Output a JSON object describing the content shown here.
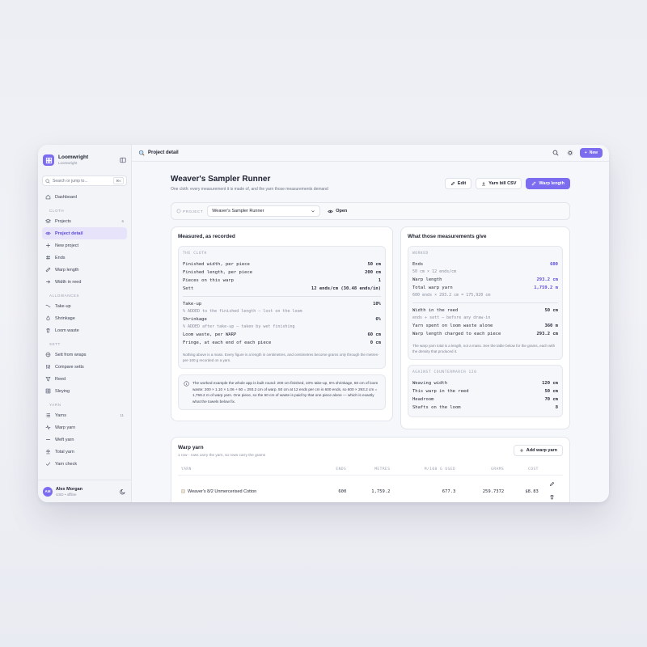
{
  "app": {
    "name": "Loomwright",
    "subtitle": "Loomwright"
  },
  "search": {
    "placeholder": "Search or jump to...",
    "shortcut": "⌘K"
  },
  "nav": {
    "top": [
      {
        "label": "Dashboard",
        "icon": "home-icon"
      }
    ],
    "cloth": {
      "heading": "CLOTH",
      "items": [
        {
          "label": "Projects",
          "count": "6",
          "icon": "layers-icon"
        },
        {
          "label": "Project detail",
          "icon": "eye-icon"
        },
        {
          "label": "New project",
          "icon": "plus-icon"
        },
        {
          "label": "Ends",
          "icon": "hash-icon"
        },
        {
          "label": "Warp length",
          "icon": "ruler-icon"
        },
        {
          "label": "Width in reed",
          "icon": "arrow-right-icon"
        }
      ]
    },
    "allowances": {
      "heading": "ALLOWANCES",
      "items": [
        {
          "label": "Take-up",
          "icon": "wave-icon"
        },
        {
          "label": "Shrinkage",
          "icon": "droplet-icon"
        },
        {
          "label": "Loom waste",
          "icon": "trash-icon"
        }
      ]
    },
    "sett": {
      "heading": "SETT",
      "items": [
        {
          "label": "Sett from wraps",
          "icon": "target-icon"
        },
        {
          "label": "Compare setts",
          "icon": "sliders-icon"
        },
        {
          "label": "Reed",
          "icon": "filter-icon"
        },
        {
          "label": "Sleying",
          "icon": "grid-icon"
        }
      ]
    },
    "yarn": {
      "heading": "YARN",
      "items": [
        {
          "label": "Yarns",
          "count": "11",
          "icon": "list-icon"
        },
        {
          "label": "Warp yarn",
          "icon": "activity-icon"
        },
        {
          "label": "Weft yarn",
          "icon": "minus-icon"
        },
        {
          "label": "Total yarn",
          "icon": "sum-icon"
        },
        {
          "label": "Yarn check",
          "icon": "check-icon"
        }
      ]
    }
  },
  "user": {
    "initials": "AM",
    "name": "Alex Morgan",
    "meta": "USD • offline"
  },
  "topbar": {
    "breadcrumb": "Project detail",
    "new_label": "New"
  },
  "page": {
    "title": "Weaver's Sampler Runner",
    "subtitle": "One cloth: every measurement it is made of, and the yarn those measurements demand",
    "edit_label": "Edit",
    "csv_label": "Yarn bill CSV",
    "warp_label": "Warp length"
  },
  "project_bar": {
    "label": "PROJECT",
    "selected": "Weaver's Sampler Runner",
    "open_label": "Open"
  },
  "measured": {
    "title": "Measured, as recorded",
    "caption": "THE CLOTH",
    "rows1": [
      {
        "k": "Finished width, per piece",
        "v": "50 cm"
      },
      {
        "k": "Finished length, per piece",
        "v": "200 cm"
      },
      {
        "k": "Pieces on this warp",
        "v": "1"
      },
      {
        "k": "Sett",
        "v": "12 ends/cm (30.48 ends/in)"
      }
    ],
    "takeup": {
      "k": "Take-up",
      "v": "10%",
      "note": "% ADDED to the finished length — lost on the loom"
    },
    "shrinkage": {
      "k": "Shrinkage",
      "v": "6%",
      "note": "% ADDED after take-up — taken by wet finishing"
    },
    "rows2": [
      {
        "k": "Loom waste, per WARP",
        "v": "60 cm"
      },
      {
        "k": "Fringe, at each end of each piece",
        "v": "0 cm"
      }
    ],
    "footnote": "Nothing above is a mass. Every figure is a length in centimetres, and centimetres become grams only through the metres-per-100 g recorded on a yarn.",
    "info": "The worked example the whole app is built round: 200 cm finished, 10% take-up, 6% shrinkage, 60 cm of loom waste: 200 × 1.10 × 1.06 + 60 = 293.2 cm of warp. 50 cm at 12 ends per cm is 600 ends, so 600 × 293.2 cm = 1,759.2 m of warp yarn. One piece, so the 60 cm of waste is paid by that one piece alone — which is exactly what the towels below fix."
  },
  "gives": {
    "title": "What those measurements give",
    "worked_caption": "WORKED",
    "ends": {
      "k": "Ends",
      "v": "600",
      "sub": "50 cm × 12 ends/cm"
    },
    "warp_length": {
      "k": "Warp length",
      "v": "293.2 cm"
    },
    "total_warp": {
      "k": "Total warp yarn",
      "v": "1,759.2 m",
      "sub": "600 ends × 293.2 cm = 175,920 cm"
    },
    "width_reed": {
      "k": "Width in the reed",
      "v": "50 cm",
      "sub": "ends ÷ sett — before any draw-in"
    },
    "loom_waste": {
      "k": "Yarn spent on loom waste alone",
      "v": "360 m"
    },
    "charged": {
      "k": "Warp length charged to each piece",
      "v": "293.2 cm"
    },
    "footnote": "The warp yarn total is a length, not a mass. See the table below for the grams, each with the density that produced it.",
    "loom_caption": "AGAINST COUNTERMARCH 120",
    "loom_rows": [
      {
        "k": "Weaving width",
        "v": "120 cm"
      },
      {
        "k": "This warp in the reed",
        "v": "50 cm"
      },
      {
        "k": "Headroom",
        "v": "70 cm"
      },
      {
        "k": "Shafts on the loom",
        "v": "8"
      }
    ]
  },
  "warp_yarn": {
    "title": "Warp yarn",
    "subtitle": "1 row · rows carry the yarn, so rows carry the grams",
    "add_label": "Add warp yarn",
    "columns": [
      "YARN",
      "ENDS",
      "METRES",
      "M/100 G USED",
      "GRAMS",
      "COST"
    ],
    "rows": [
      {
        "yarn": "Weaver's 8/2 Unmercerised Cotton",
        "ends": "600",
        "metres": "1,759.2",
        "m100g": "677.3",
        "grams": "259.7372",
        "cost": "$8.83"
      }
    ]
  },
  "colors": {
    "accent": "#7c6cf0",
    "accent_text": "#5b4bd6"
  }
}
